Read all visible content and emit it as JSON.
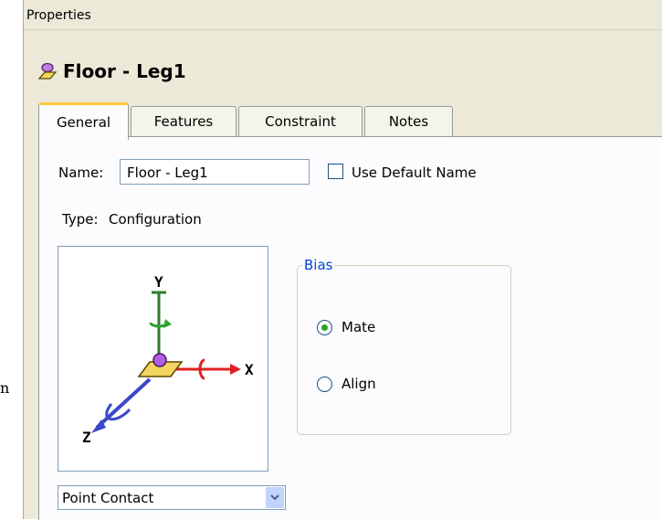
{
  "stray_text": "n",
  "panel": {
    "header": "Properties",
    "object_title": "Floor - Leg1",
    "tabs": [
      {
        "label": "General",
        "active": true
      },
      {
        "label": "Features",
        "active": false
      },
      {
        "label": "Constraint",
        "active": false
      },
      {
        "label": "Notes",
        "active": false
      }
    ]
  },
  "general": {
    "name_label": "Name:",
    "name_value": "Floor - Leg1",
    "use_default_label": "Use Default Name",
    "use_default_checked": false,
    "type_label": "Type:",
    "type_value": "Configuration",
    "axes": {
      "y": "Y",
      "x": "X",
      "z": "Z"
    },
    "bias": {
      "title": "Bias",
      "options": [
        {
          "label": "Mate",
          "selected": true
        },
        {
          "label": "Align",
          "selected": false
        }
      ]
    },
    "contact_select": {
      "value": "Point Contact"
    }
  },
  "colors": {
    "active_tab_accent": "#ffc83c",
    "groupbox_title": "#0046d5",
    "radio_dot": "#2ca12c",
    "panel_bg": "#ece9d8"
  }
}
